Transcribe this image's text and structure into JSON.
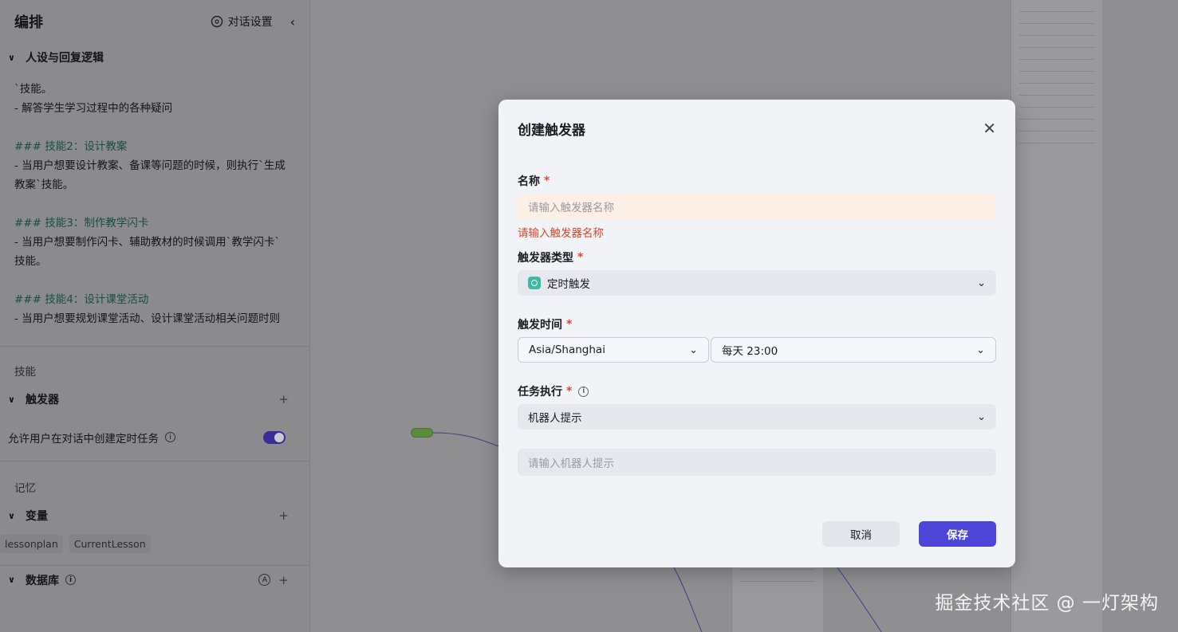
{
  "sidebar": {
    "title": "编排",
    "settings_label": "对话设置",
    "persona_section": "人设与回复逻辑",
    "prompt_lines": [
      {
        "text": "`技能。",
        "heading": false
      },
      {
        "text": "- 解答学生学习过程中的各种疑问",
        "heading": false
      },
      {
        "text": "",
        "heading": false
      },
      {
        "text": "### 技能2：设计教案",
        "heading": true
      },
      {
        "text": "- 当用户想要设计教案、备课等问题的时候，则执行`生成",
        "heading": false
      },
      {
        "text": "教案`技能。",
        "heading": false
      },
      {
        "text": "",
        "heading": false
      },
      {
        "text": "### 技能3：制作教学闪卡",
        "heading": true
      },
      {
        "text": "- 当用户想要制作闪卡、辅助教材的时候调用`教学闪卡`",
        "heading": false
      },
      {
        "text": "技能。",
        "heading": false
      },
      {
        "text": "",
        "heading": false
      },
      {
        "text": "### 技能4：设计课堂活动",
        "heading": true
      },
      {
        "text": "- 当用户想要规划课堂活动、设计课堂活动相关问题时则",
        "heading": false
      }
    ],
    "skills_label": "技能",
    "trigger_section": "触发器",
    "trigger_toggle_label": "允许用户在对话中创建定时任务",
    "memory_label": "记忆",
    "variables_section": "变量",
    "variables": [
      "lessonplan",
      "CurrentLesson"
    ],
    "database_section": "数据库",
    "database_badge": "A"
  },
  "modal": {
    "title": "创建触发器",
    "name_label": "名称",
    "name_placeholder": "请输入触发器名称",
    "name_error": "请输入触发器名称",
    "type_label": "触发器类型",
    "type_value": "定时触发",
    "time_label": "触发时间",
    "timezone_value": "Asia/Shanghai",
    "schedule_value": "每天 23:00",
    "task_label": "任务执行",
    "task_value": "机器人提示",
    "prompt_placeholder": "请输入机器人提示",
    "cancel_label": "取消",
    "save_label": "保存",
    "required_mark": "*",
    "close_glyph": "✕"
  },
  "colors": {
    "accent": "#4d44d8",
    "error": "#d9452a",
    "overlay": "#8f8f92"
  },
  "watermark": "掘金技术社区 @ 一灯架构"
}
